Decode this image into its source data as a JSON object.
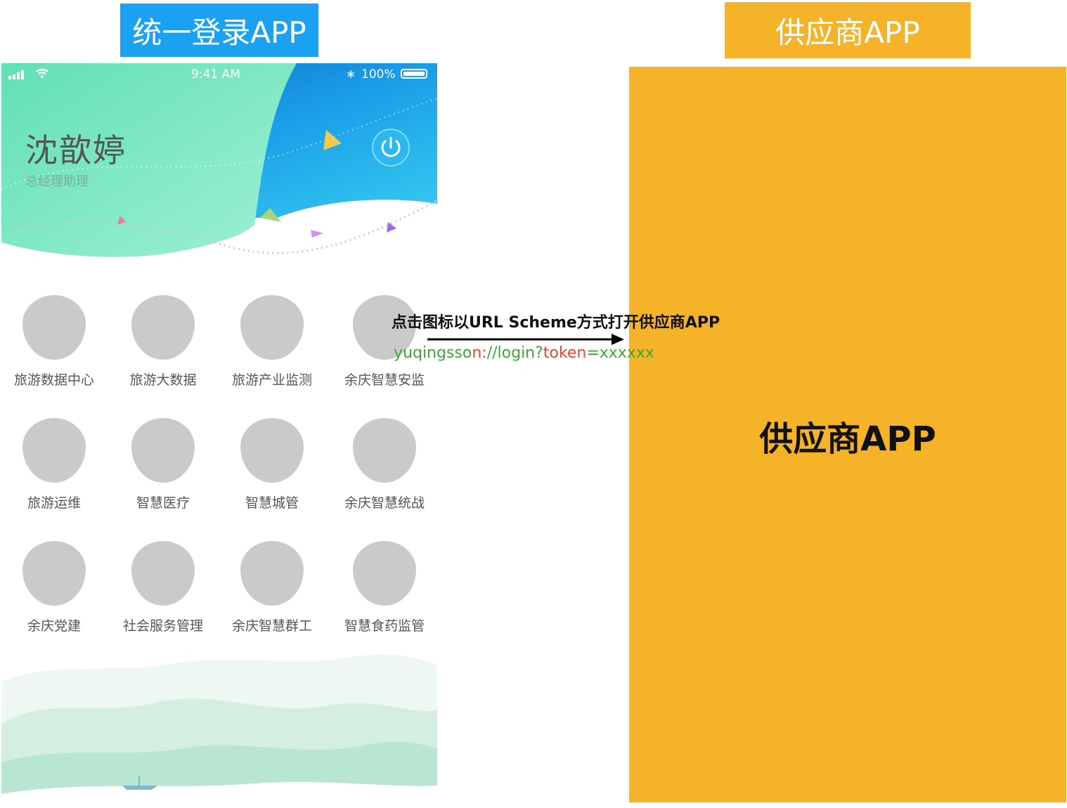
{
  "titles": {
    "left": "统一登录APP",
    "right": "供应商APP"
  },
  "phone": {
    "status": {
      "time": "9:41 AM",
      "battery": "100%"
    },
    "user": {
      "name": "沈歆婷",
      "role": "总经理助理"
    },
    "apps": [
      "旅游数据中心",
      "旅游大数据",
      "旅游产业监测",
      "余庆智慧安监",
      "旅游运维",
      "智慧医疗",
      "智慧城管",
      "余庆智慧统战",
      "余庆党建",
      "社会服务管理",
      "余庆智慧群工",
      "智慧食药监管"
    ]
  },
  "annotation": {
    "text": "点击图标以URL Scheme方式打开供应商APP",
    "url": {
      "scheme": "yuqingsso",
      "colon": "n:",
      "path": "//login?",
      "token_key": "token",
      "token_value": "=xxxxxx"
    }
  },
  "supplier": {
    "label": "供应商APP"
  },
  "colors": {
    "blue": "#1ba1f2",
    "orange": "#f5b32a",
    "green": "#3aaa35",
    "red": "#e8452c",
    "placeholder": "#cacaca"
  }
}
